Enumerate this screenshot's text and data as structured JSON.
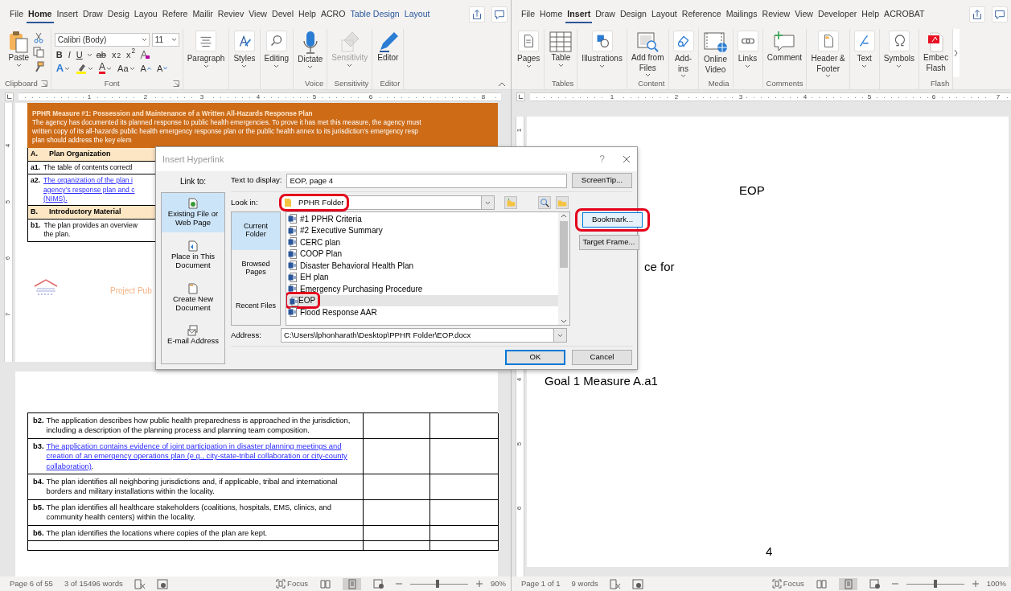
{
  "left_window": {
    "ribbon_tabs": [
      {
        "label": "File",
        "selected": false,
        "contextual": false
      },
      {
        "label": "Home",
        "selected": true,
        "contextual": false
      },
      {
        "label": "Insert",
        "selected": false,
        "contextual": false
      },
      {
        "label": "Draw",
        "selected": false,
        "contextual": false
      },
      {
        "label": "Desig",
        "selected": false,
        "contextual": false
      },
      {
        "label": "Layou",
        "selected": false,
        "contextual": false
      },
      {
        "label": "Refere",
        "selected": false,
        "contextual": false
      },
      {
        "label": "Mailir",
        "selected": false,
        "contextual": false
      },
      {
        "label": "Reviev",
        "selected": false,
        "contextual": false
      },
      {
        "label": "View",
        "selected": false,
        "contextual": false
      },
      {
        "label": "Devel",
        "selected": false,
        "contextual": false
      },
      {
        "label": "Help",
        "selected": false,
        "contextual": false
      },
      {
        "label": "ACRO",
        "selected": false,
        "contextual": false
      },
      {
        "label": "Table Design",
        "selected": false,
        "contextual": true
      },
      {
        "label": "Layout",
        "selected": false,
        "contextual": true
      }
    ],
    "ribbon_groups": [
      {
        "kind": "clipboard",
        "label": "Clipboard",
        "launcher": true,
        "commands": [
          {
            "label": "Paste",
            "caret": true,
            "disabled": false
          }
        ]
      },
      {
        "kind": "font",
        "label": "Font",
        "launcher": true,
        "font": {
          "name": "Calibri (Body)",
          "size": "11",
          "format_buttons": [
            "B",
            "I",
            "U",
            "ab",
            "x$_{2}$",
            "x$^{2}$"
          ],
          "effects_glyph": "A",
          "color_glyph": "A",
          "case_glyph": "Aa",
          "grow_glyph": "A",
          "shrink_glyph": "A"
        }
      },
      {
        "kind": "commands",
        "commands": [
          {
            "label": "Paragraph",
            "caret": true,
            "disabled": false
          }
        ]
      },
      {
        "kind": "commands",
        "commands": [
          {
            "label": "Styles",
            "caret": true,
            "disabled": false
          }
        ]
      },
      {
        "kind": "commands",
        "commands": [
          {
            "label": "Editing",
            "caret": true,
            "disabled": false
          }
        ]
      },
      {
        "kind": "commands",
        "label": "Voice",
        "commands": [
          {
            "label": "Dictate",
            "caret": true,
            "disabled": false
          }
        ]
      },
      {
        "kind": "commands",
        "label": "Sensitivity",
        "commands": [
          {
            "label": "Sensitivity",
            "caret": true,
            "disabled": true
          }
        ]
      },
      {
        "kind": "commands",
        "label": "Editor",
        "commands": [
          {
            "label": "Editor",
            "caret": false,
            "disabled": false
          }
        ]
      }
    ],
    "ruler_numbers": [
      "1",
      "2",
      "3",
      "4",
      "5",
      "6",
      "8"
    ],
    "vertical_ruler_numbers": [
      "4",
      "5",
      "6",
      "7"
    ],
    "document": {
      "header": {
        "title": "PPHR Measure #1: Possession and Maintenance of a Written All-Hazards Response Plan",
        "lines": [
          "The agency has documented its planned response to public health emergencies. To prove it has met this measure, the agency must",
          "written copy of its all-hazards public health emergency response plan or the public health annex to its jurisdiction’s emergency resp",
          "plan should address the key elem"
        ]
      },
      "top_rows": [
        {
          "kind": "section",
          "number": "A.",
          "title": "Plan Organization"
        },
        {
          "kind": "item",
          "number": "a1.",
          "lines": [
            "The table of contents correctl"
          ],
          "link": false
        },
        {
          "kind": "item",
          "number": "a2.",
          "lines": [
            "The organization of the plan i",
            "agency’s response plan and c",
            "(NIMS)."
          ],
          "link": true
        },
        {
          "kind": "section",
          "number": "B.",
          "title": "Introductory Material"
        },
        {
          "kind": "item",
          "number": "b1.",
          "lines": [
            "The plan provides an overview",
            "the plan."
          ],
          "link": false
        }
      ],
      "footer_text": "Project Pub",
      "bottom_rows": [
        {
          "kind": "item",
          "number": "b2.",
          "text": "The application describes how public health preparedness is approached in the jurisdiction, including a description of the planning process and planning team composition.",
          "link": false
        },
        {
          "kind": "item",
          "number": "b3.",
          "text": "The application contains evidence of joint participation in disaster planning meetings and creation of an emergency operations plan (e.g., city-state-tribal collaboration or city-county collaboration)",
          "suffix": ".",
          "link": true
        },
        {
          "kind": "item",
          "number": "b4.",
          "text": "The plan identifies all neighboring jurisdictions and, if applicable, tribal and international borders and military installations within the locality.",
          "link": false
        },
        {
          "kind": "item",
          "number": "b5.",
          "text": "The plan identifies all healthcare stakeholders (coalitions, hospitals, EMS, clinics, and community health centers) within the locality.",
          "link": false
        },
        {
          "kind": "item",
          "number": "b6.",
          "text": "The plan identifies the locations where copies of the plan are kept.",
          "link": false
        },
        {
          "kind": "blank"
        }
      ]
    },
    "status_bar": {
      "page": "Page 6 of 55",
      "words": "3 of 15496 words",
      "focus": "Focus",
      "views": [
        {
          "selected": false
        },
        {
          "selected": true
        },
        {
          "selected": false
        }
      ],
      "zoom": {
        "level": 0.47,
        "reading": "90%"
      }
    }
  },
  "right_window": {
    "ribbon_tabs": [
      {
        "label": "File",
        "selected": false,
        "contextual": false
      },
      {
        "label": "Home",
        "selected": false,
        "contextual": false
      },
      {
        "label": "Insert",
        "selected": true,
        "contextual": false
      },
      {
        "label": "Draw",
        "selected": false,
        "contextual": false
      },
      {
        "label": "Design",
        "selected": false,
        "contextual": false
      },
      {
        "label": "Layout",
        "selected": false,
        "contextual": false
      },
      {
        "label": "Reference",
        "selected": false,
        "contextual": false
      },
      {
        "label": "Mailings",
        "selected": false,
        "contextual": false
      },
      {
        "label": "Review",
        "selected": false,
        "contextual": false
      },
      {
        "label": "View",
        "selected": false,
        "contextual": false
      },
      {
        "label": "Developer",
        "selected": false,
        "contextual": false
      },
      {
        "label": "Help",
        "selected": false,
        "contextual": false
      },
      {
        "label": "ACROBAT",
        "selected": false,
        "contextual": false
      }
    ],
    "ribbon_groups": [
      {
        "kind": "commands",
        "commands": [
          {
            "label": "Pages",
            "caret": true,
            "disabled": false
          }
        ]
      },
      {
        "kind": "commands",
        "label": "Tables",
        "commands": [
          {
            "label": "Table",
            "caret": true,
            "disabled": false
          }
        ]
      },
      {
        "kind": "commands",
        "commands": [
          {
            "label": "Illustrations",
            "caret": true,
            "disabled": false
          }
        ]
      },
      {
        "kind": "commands",
        "label": "Content",
        "commands": [
          {
            "label": "Add from\nFiles",
            "caret": true,
            "disabled": false
          }
        ]
      },
      {
        "kind": "commands",
        "commands": [
          {
            "label": "Add-\nins",
            "caret": true,
            "disabled": false
          }
        ]
      },
      {
        "kind": "commands",
        "label": "Media",
        "commands": [
          {
            "label": "Online\nVideo",
            "caret": false,
            "disabled": false
          }
        ]
      },
      {
        "kind": "commands",
        "commands": [
          {
            "label": "Links",
            "caret": true,
            "disabled": false
          }
        ]
      },
      {
        "kind": "commands",
        "label": "Comments",
        "commands": [
          {
            "label": "Comment",
            "caret": false,
            "disabled": false
          }
        ]
      },
      {
        "kind": "commands",
        "commands": [
          {
            "label": "Header &\nFooter",
            "caret": true,
            "disabled": false
          }
        ]
      },
      {
        "kind": "commands",
        "commands": [
          {
            "label": "Text",
            "caret": true,
            "disabled": false
          }
        ]
      },
      {
        "kind": "commands",
        "commands": [
          {
            "label": "Symbols",
            "caret": true,
            "disabled": false
          }
        ]
      },
      {
        "kind": "commands",
        "label": "Flash",
        "commands": [
          {
            "label": "Embec\nFlash",
            "caret": false,
            "disabled": false
          }
        ]
      }
    ],
    "ruler_numbers": [
      "1",
      "2",
      "3",
      "4",
      "5",
      "6",
      "7"
    ],
    "vertical_ruler_numbers": [
      "1",
      "4",
      "5",
      "6"
    ],
    "document": {
      "texts": [
        {
          "kind": "title",
          "text": "EOP"
        },
        {
          "kind": "fragment",
          "text": "ce for"
        },
        {
          "kind": "heading",
          "text": "Goal 1 Measure A.a1"
        },
        {
          "kind": "page_number",
          "text": "4"
        }
      ]
    },
    "status_bar": {
      "page": "Page 1 of 1",
      "words": "9 words",
      "focus": "Focus",
      "views": [
        {
          "selected": false
        },
        {
          "selected": true
        },
        {
          "selected": false
        }
      ],
      "zoom": {
        "level": 0.5,
        "reading": "100%"
      }
    }
  },
  "dialog": {
    "title": "Insert Hyperlink",
    "help": "?",
    "link_to_label": "Link to:",
    "link_to": [
      {
        "label": "Existing File or\nWeb Page",
        "selected": true
      },
      {
        "label": "Place in This\nDocument",
        "selected": false
      },
      {
        "label": "Create New\nDocument",
        "selected": false
      },
      {
        "label": "E-mail Address",
        "selected": false
      }
    ],
    "text_to_display": {
      "label": "Text to display:",
      "value": "EOP, page 4"
    },
    "screentip_button": "ScreenTip...",
    "look_in": {
      "label": "Look in:",
      "value": "PPHR Folder",
      "highlighted": true
    },
    "browse_tabs": [
      {
        "label": "Current Folder",
        "selected": true
      },
      {
        "label": "Browsed Pages",
        "selected": false
      },
      {
        "label": "Recent Files",
        "selected": false
      }
    ],
    "files": [
      {
        "name": "#1 PPHR Criteria",
        "selected": false,
        "highlighted": false
      },
      {
        "name": "#2 Executive Summary",
        "selected": false,
        "highlighted": false
      },
      {
        "name": "CERC plan",
        "selected": false,
        "highlighted": false
      },
      {
        "name": "COOP Plan",
        "selected": false,
        "highlighted": false
      },
      {
        "name": "Disaster Behavioral Health Plan",
        "selected": false,
        "highlighted": false
      },
      {
        "name": "EH plan",
        "selected": false,
        "highlighted": false
      },
      {
        "name": "Emergency Purchasing Procedure",
        "selected": false,
        "highlighted": false
      },
      {
        "name": "EOP",
        "selected": true,
        "highlighted": true
      },
      {
        "name": "Flood Response AAR",
        "selected": false,
        "highlighted": false
      }
    ],
    "side_buttons": [
      {
        "label": "Bookmark...",
        "hovered": true,
        "highlighted": true
      },
      {
        "label": "Target Frame...",
        "hovered": false,
        "highlighted": false
      }
    ],
    "address": {
      "label": "Address:",
      "value": "C:\\Users\\lphonharath\\Desktop\\PPHR Folder\\EOP.docx"
    },
    "buttons": [
      {
        "label": "OK",
        "default": true
      },
      {
        "label": "Cancel",
        "default": false
      }
    ]
  }
}
